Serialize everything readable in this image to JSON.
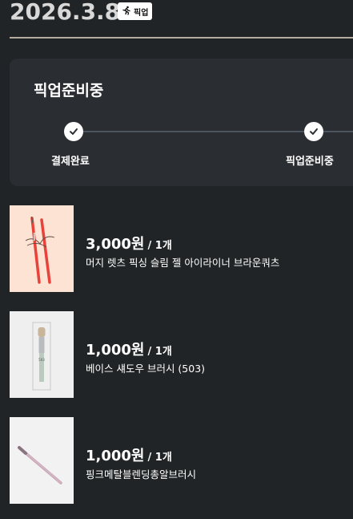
{
  "header": {
    "date": "2026.3.8",
    "badge_label": "픽업"
  },
  "status": {
    "title": "픽업준비중",
    "steps": [
      {
        "label": "결제완료",
        "done": true
      },
      {
        "label": "픽업준비중",
        "done": true
      }
    ]
  },
  "items": [
    {
      "price": "3,000원",
      "qty": "/ 1개",
      "name": "머지 렛츠 픽싱 슬림 젤 아이라이너 브라운쿼츠"
    },
    {
      "price": "1,000원",
      "qty": "/ 1개",
      "name": "베이스 섀도우 브러시 (503)"
    },
    {
      "price": "1,000원",
      "qty": "/ 1개",
      "name": "핑크메탈블렌딩총알브러시"
    }
  ],
  "colors": {
    "background": "#212426",
    "card": "#2a2e32",
    "divider": "#b5ab9e",
    "progress_line": "#4c5460"
  }
}
